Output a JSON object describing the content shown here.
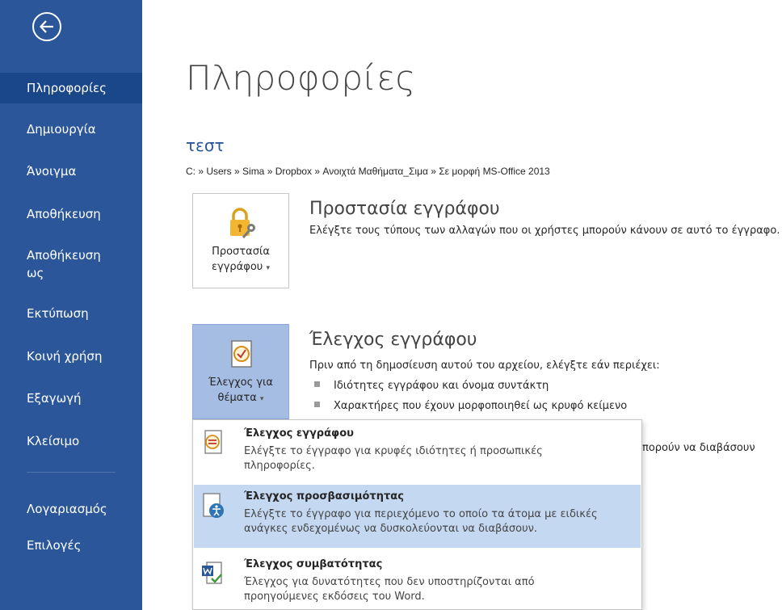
{
  "sidebar": {
    "back_icon": "arrow-left-circle-icon",
    "items": [
      {
        "label": "Πληροφορίες",
        "selected": true
      },
      {
        "label": "Δημιουργία"
      },
      {
        "label": "Άνοιγμα"
      },
      {
        "label": "Αποθήκευση"
      },
      {
        "label": "Αποθήκευση ως"
      },
      {
        "label": "Εκτύπωση"
      },
      {
        "label": "Κοινή χρήση"
      },
      {
        "label": "Εξαγωγή"
      },
      {
        "label": "Κλείσιμο"
      },
      {
        "label": "Λογαριασμός"
      },
      {
        "label": "Επιλογές"
      }
    ],
    "bg_color": "#2b579a"
  },
  "main": {
    "title": "Πληροφορίες",
    "doc_name": "τεστ",
    "path": "C: » Users » Sima » Dropbox » Ανοιχτά Μαθήματα_Σιμα » Σε μορφή MS-Office 2013",
    "protect": {
      "button_line1": "Προστασία",
      "button_line2": "εγγράφου",
      "icon": "lock-key-icon",
      "title": "Προστασία εγγράφου",
      "desc": "Ελέγξτε τους τύπους των αλλαγών που οι χρήστες μπορούν κάνουν σε αυτό το έγγραφο."
    },
    "inspect": {
      "button_line1": "Έλεγχος για",
      "button_line2": "θέματα",
      "icon": "document-check-icon",
      "title": "Έλεγχος εγγράφου",
      "desc": "Πριν από τη δημοσίευση αυτού του αρχείου, ελέγξτε εάν περιέχει:",
      "bullets": [
        "Ιδιότητες εγγράφου και όνομα συντάκτη",
        "Χαρακτήρες που έχουν μορφοποιηθεί ως κρυφό κείμενο"
      ],
      "partial_text": "πορούν να διαβάσουν"
    }
  },
  "dropdown": {
    "items": [
      {
        "title": "Έλεγχος εγγράφου",
        "desc": "Ελέγξτε το έγγραφο για κρυφές ιδιότητες ή προσωπικές πληροφορίες.",
        "icon": "inspect-document-icon"
      },
      {
        "title": "Έλεγχος προσβασιμότητας",
        "desc": "Ελέγξτε το έγγραφο για περιεχόμενο το οποίο τα άτομα με ειδικές ανάγκες ενδεχομένως να δυσκολεύονται να διαβάσουν.",
        "icon": "accessibility-check-icon",
        "hovered": true
      },
      {
        "title": "Έλεγχος συμβατότητας",
        "desc": "Έλεγχος για δυνατότητες που δεν υποστηρίζονται από προηγούμενες εκδόσεις του Word.",
        "icon": "compatibility-check-icon"
      }
    ]
  }
}
